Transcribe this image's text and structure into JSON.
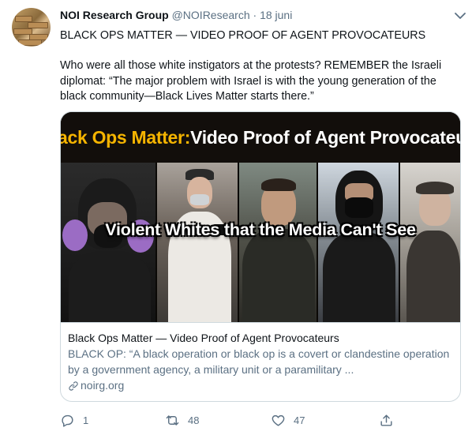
{
  "tweet": {
    "author_name": "NOI Research Group",
    "author_handle": "@NOIResearch",
    "separator": "·",
    "date": "18 juni",
    "headline": "BLACK OPS MATTER — VIDEO PROOF OF AGENT PROVOCATEURS",
    "body": "Who were all those white instigators at the protests? REMEMBER the Israeli diplomat: “The major problem with Israel is with the young generation of the black community—Black Lives Matter starts there.”"
  },
  "card": {
    "image_title_yellow": "ack Ops Matter:",
    "image_title_white": " Video Proof of Agent Provocateur",
    "image_overlay": "Violent Whites that the Media Can't See",
    "title": "Black Ops Matter — Video Proof of Agent Provocateurs",
    "description": "BLACK OP: “A black operation or black op is a covert or clandestine operation by a government agency, a military unit or a paramilitary ...",
    "domain": "noirg.org"
  },
  "actions": {
    "reply_count": "1",
    "retweet_count": "48",
    "like_count": "47"
  },
  "colors": {
    "secondary_text": "#5b7083",
    "border": "#cfd9de",
    "image_title_yellow": "#f5b400"
  },
  "icons": [
    "avatar",
    "caret-down-icon",
    "link-icon",
    "reply-icon",
    "retweet-icon",
    "like-icon",
    "share-icon"
  ]
}
